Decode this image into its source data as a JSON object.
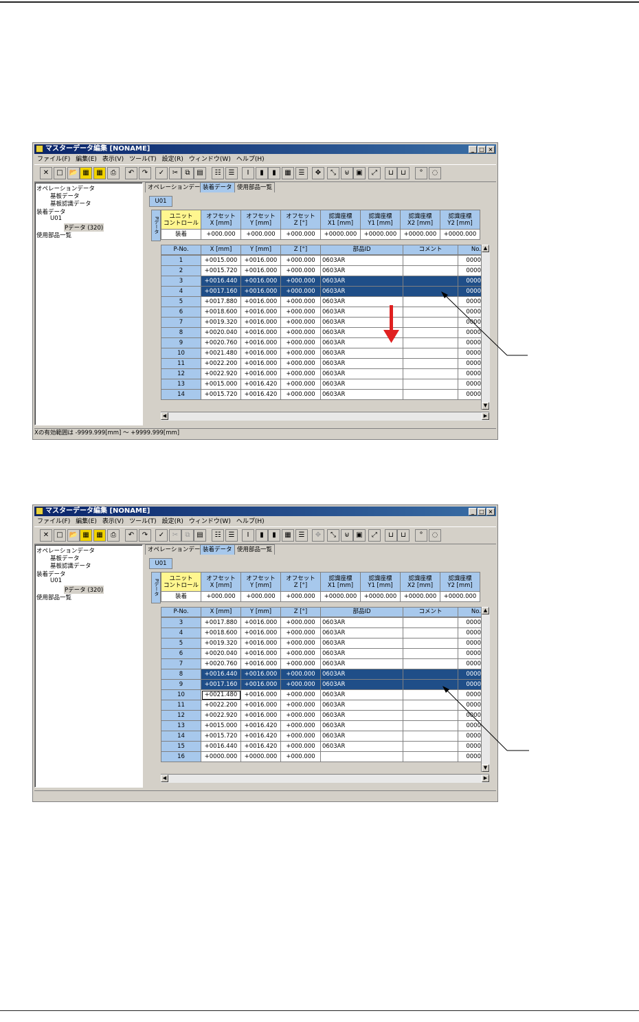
{
  "screens": [
    {
      "window_title": "マスターデータ編集 [NONAME]",
      "menu": [
        "ファイル(F)",
        "編集(E)",
        "表示(V)",
        "ツール(T)",
        "設定(R)",
        "ウィンドウ(W)",
        "ヘルプ(H)"
      ],
      "tree": {
        "operation": "オペレーションデータ",
        "board": "基板データ",
        "board_recog": "基板認識データ",
        "mount": "装着データ",
        "unit": "U01",
        "pdata": "Pデータ (320)",
        "parts_list": "使用部品一覧"
      },
      "tabs": [
        "オペレーションデータ",
        "装着データ",
        "使用部品一覧"
      ],
      "active_tab": "装着データ",
      "unit_tab": "U01",
      "side_tab": "Pデータ",
      "offset_headers": [
        [
          "ユニット",
          "コントロール"
        ],
        [
          "オフセット",
          "X [mm]"
        ],
        [
          "オフセット",
          "Y [mm]"
        ],
        [
          "オフセット",
          "Z [°]"
        ],
        [
          "認識座標",
          "X1 [mm]"
        ],
        [
          "認識座標",
          "Y1 [mm]"
        ],
        [
          "認識座標",
          "X2 [mm]"
        ],
        [
          "認識座標",
          "Y2 [mm]"
        ]
      ],
      "offset_values": [
        "装着",
        "+000.000",
        "+000.000",
        "+000.000",
        "+0000.000",
        "+0000.000",
        "+0000.000",
        "+0000.000"
      ],
      "grid_headers": [
        "P-No.",
        "X [mm]",
        "Y [mm]",
        "Z [°]",
        "部品ID",
        "コメント",
        "No."
      ],
      "rows": [
        [
          "1",
          "+0015.000",
          "+0016.000",
          "+000.000",
          "0603AR",
          "",
          "0000"
        ],
        [
          "2",
          "+0015.720",
          "+0016.000",
          "+000.000",
          "0603AR",
          "",
          "0000"
        ],
        [
          "3",
          "+0016.440",
          "+0016.000",
          "+000.000",
          "0603AR",
          "",
          "0000"
        ],
        [
          "4",
          "+0017.160",
          "+0016.000",
          "+000.000",
          "0603AR",
          "",
          "0000"
        ],
        [
          "5",
          "+0017.880",
          "+0016.000",
          "+000.000",
          "0603AR",
          "",
          "0000"
        ],
        [
          "6",
          "+0018.600",
          "+0016.000",
          "+000.000",
          "0603AR",
          "",
          "0000"
        ],
        [
          "7",
          "+0019.320",
          "+0016.000",
          "+000.000",
          "0603AR",
          "",
          "0000"
        ],
        [
          "8",
          "+0020.040",
          "+0016.000",
          "+000.000",
          "0603AR",
          "",
          "0000"
        ],
        [
          "9",
          "+0020.760",
          "+0016.000",
          "+000.000",
          "0603AR",
          "",
          "0000"
        ],
        [
          "10",
          "+0021.480",
          "+0016.000",
          "+000.000",
          "0603AR",
          "",
          "0000"
        ],
        [
          "11",
          "+0022.200",
          "+0016.000",
          "+000.000",
          "0603AR",
          "",
          "0000"
        ],
        [
          "12",
          "+0022.920",
          "+0016.000",
          "+000.000",
          "0603AR",
          "",
          "0000"
        ],
        [
          "13",
          "+0015.000",
          "+0016.420",
          "+000.000",
          "0603AR",
          "",
          "0000"
        ],
        [
          "14",
          "+0015.720",
          "+0016.420",
          "+000.000",
          "0603AR",
          "",
          "0000"
        ]
      ],
      "selected_rows": [
        2,
        3
      ],
      "edit_row": -1,
      "status": "Xの有効範囲は -9999.999[mm] ～ +9999.999[mm]"
    },
    {
      "window_title": "マスターデータ編集 [NONAME]",
      "menu": [
        "ファイル(F)",
        "編集(E)",
        "表示(V)",
        "ツール(T)",
        "設定(R)",
        "ウィンドウ(W)",
        "ヘルプ(H)"
      ],
      "tree": {
        "operation": "オペレーションデータ",
        "board": "基板データ",
        "board_recog": "基板認識データ",
        "mount": "装着データ",
        "unit": "U01",
        "pdata": "Pデータ (320)",
        "parts_list": "使用部品一覧"
      },
      "tabs": [
        "オペレーションデータ",
        "装着データ",
        "使用部品一覧"
      ],
      "active_tab": "装着データ",
      "unit_tab": "U01",
      "side_tab": "Pデータ",
      "offset_headers": [
        [
          "ユニット",
          "コントロール"
        ],
        [
          "オフセット",
          "X [mm]"
        ],
        [
          "オフセット",
          "Y [mm]"
        ],
        [
          "オフセット",
          "Z [°]"
        ],
        [
          "認識座標",
          "X1 [mm]"
        ],
        [
          "認識座標",
          "Y1 [mm]"
        ],
        [
          "認識座標",
          "X2 [mm]"
        ],
        [
          "認識座標",
          "Y2 [mm]"
        ]
      ],
      "offset_values": [
        "装着",
        "+000.000",
        "+000.000",
        "+000.000",
        "+0000.000",
        "+0000.000",
        "+0000.000",
        "+0000.000"
      ],
      "grid_headers": [
        "P-No.",
        "X [mm]",
        "Y [mm]",
        "Z [°]",
        "部品ID",
        "コメント",
        "No."
      ],
      "rows": [
        [
          "3",
          "+0017.880",
          "+0016.000",
          "+000.000",
          "0603AR",
          "",
          "0000"
        ],
        [
          "4",
          "+0018.600",
          "+0016.000",
          "+000.000",
          "0603AR",
          "",
          "0000"
        ],
        [
          "5",
          "+0019.320",
          "+0016.000",
          "+000.000",
          "0603AR",
          "",
          "0000"
        ],
        [
          "6",
          "+0020.040",
          "+0016.000",
          "+000.000",
          "0603AR",
          "",
          "0000"
        ],
        [
          "7",
          "+0020.760",
          "+0016.000",
          "+000.000",
          "0603AR",
          "",
          "0000"
        ],
        [
          "8",
          "+0016.440",
          "+0016.000",
          "+000.000",
          "0603AR",
          "",
          "0000"
        ],
        [
          "9",
          "+0017.160",
          "+0016.000",
          "+000.000",
          "0603AR",
          "",
          "0000"
        ],
        [
          "10",
          "+0021.480",
          "+0016.000",
          "+000.000",
          "0603AR",
          "",
          "0000"
        ],
        [
          "11",
          "+0022.200",
          "+0016.000",
          "+000.000",
          "0603AR",
          "",
          "0000"
        ],
        [
          "12",
          "+0022.920",
          "+0016.000",
          "+000.000",
          "0603AR",
          "",
          "0000"
        ],
        [
          "13",
          "+0015.000",
          "+0016.420",
          "+000.000",
          "0603AR",
          "",
          "0000"
        ],
        [
          "14",
          "+0015.720",
          "+0016.420",
          "+000.000",
          "0603AR",
          "",
          "0000"
        ],
        [
          "15",
          "+0016.440",
          "+0016.420",
          "+000.000",
          "0603AR",
          "",
          "0000"
        ],
        [
          "16",
          "+0000.000",
          "+0000.000",
          "+000.000",
          "",
          "",
          "0000"
        ]
      ],
      "selected_rows": [
        5,
        6
      ],
      "edit_row": 7,
      "status": ""
    }
  ]
}
